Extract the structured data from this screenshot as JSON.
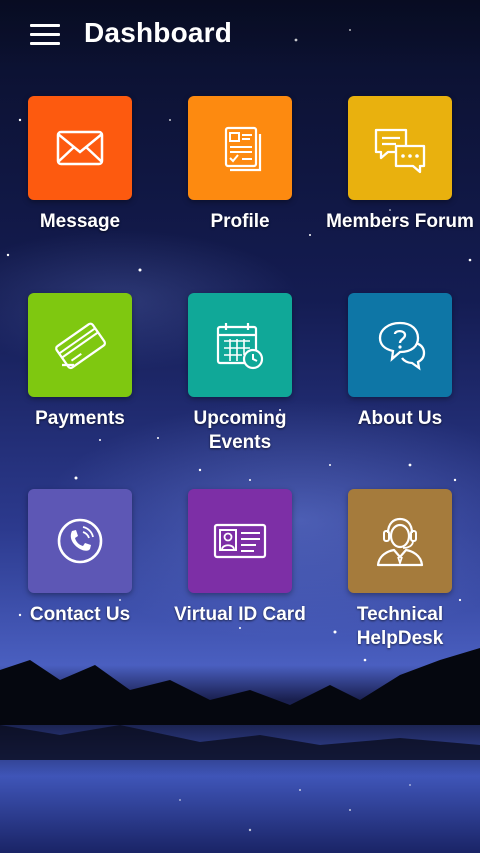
{
  "header": {
    "title": "Dashboard",
    "menu_icon": "hamburger-menu-icon"
  },
  "tiles": [
    {
      "label": "Message",
      "icon": "envelope-icon",
      "color": "#fd5a0f"
    },
    {
      "label": "Profile",
      "icon": "document-list-icon",
      "color": "#fd8a10"
    },
    {
      "label": "Members Forum",
      "icon": "chat-bubbles-icon",
      "color": "#e9b10e"
    },
    {
      "label": "Payments",
      "icon": "credit-card-icon",
      "color": "#7fc810"
    },
    {
      "label": "Upcoming Events",
      "icon": "calendar-clock-icon",
      "color": "#10a898"
    },
    {
      "label": "About Us",
      "icon": "question-chat-icon",
      "color": "#0e76a6"
    },
    {
      "label": "Contact Us",
      "icon": "phone-icon",
      "color": "#5d57b5"
    },
    {
      "label": "Virtual ID Card",
      "icon": "id-card-icon",
      "color": "#7d2fa6"
    },
    {
      "label": "Technical\nHelpDesk",
      "icon": "support-agent-icon",
      "color": "#a57b3c"
    }
  ]
}
